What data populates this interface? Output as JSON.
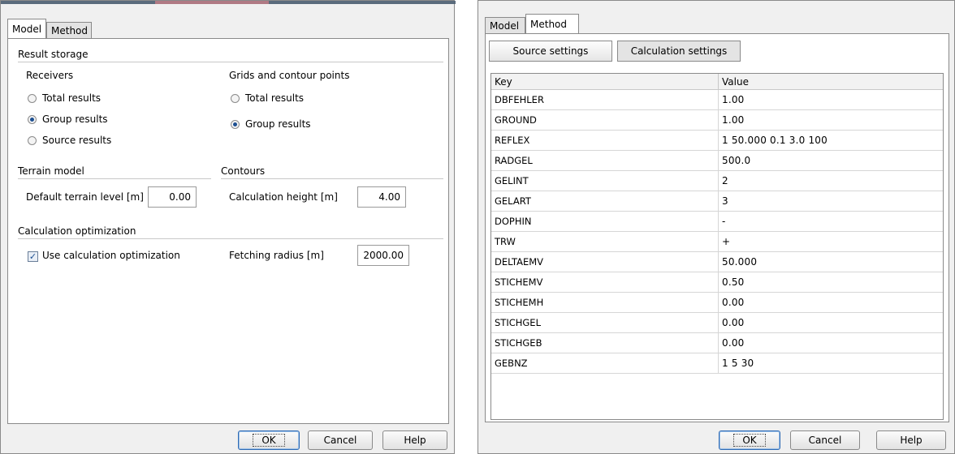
{
  "left": {
    "tabs": [
      {
        "label": "Model",
        "active": true
      },
      {
        "label": "Method",
        "active": false
      }
    ],
    "result_storage": {
      "title": "Result storage",
      "receivers": {
        "label": "Receivers",
        "options": [
          {
            "label": "Total results",
            "selected": false
          },
          {
            "label": "Group results",
            "selected": true
          },
          {
            "label": "Source results",
            "selected": false
          }
        ]
      },
      "grids": {
        "label": "Grids and contour points",
        "options": [
          {
            "label": "Total results",
            "selected": false
          },
          {
            "label": "Group results",
            "selected": true
          }
        ]
      }
    },
    "terrain": {
      "title": "Terrain model",
      "field_label": "Default terrain level [m]",
      "field_value": "0.00"
    },
    "contours": {
      "title": "Contours",
      "field_label": "Calculation height [m]",
      "field_value": "4.00"
    },
    "optimization": {
      "title": "Calculation optimization",
      "checkbox_label": "Use calculation optimization",
      "checked": true,
      "radius_label": "Fetching radius [m]",
      "radius_value": "2000.00"
    },
    "buttons": {
      "ok": "OK",
      "cancel": "Cancel",
      "help": "Help"
    }
  },
  "right": {
    "tabs": [
      {
        "label": "Model",
        "active": false
      },
      {
        "label": "Method",
        "active": true
      }
    ],
    "settings_buttons": {
      "source": "Source settings",
      "calculation": "Calculation settings"
    },
    "table": {
      "headers": {
        "key": "Key",
        "value": "Value"
      },
      "rows": [
        {
          "key": "DBFEHLER",
          "value": "1.00"
        },
        {
          "key": "GROUND",
          "value": "1.00"
        },
        {
          "key": "REFLEX",
          "value": "1 50.000 0.1 3.0 100"
        },
        {
          "key": "RADGEL",
          "value": "500.0"
        },
        {
          "key": "GELINT",
          "value": "2"
        },
        {
          "key": "GELART",
          "value": "3"
        },
        {
          "key": "DOPHIN",
          "value": "-"
        },
        {
          "key": "TRW",
          "value": "+"
        },
        {
          "key": "DELTAEMV",
          "value": "50.000"
        },
        {
          "key": "STICHEMV",
          "value": "0.50"
        },
        {
          "key": "STICHEMH",
          "value": "0.00"
        },
        {
          "key": "STICHGEL",
          "value": "0.00"
        },
        {
          "key": "STICHGEB",
          "value": "0.00"
        },
        {
          "key": "GEBNZ",
          "value": "1 5 30"
        }
      ]
    },
    "buttons": {
      "ok": "OK",
      "cancel": "Cancel",
      "help": "Help"
    }
  }
}
